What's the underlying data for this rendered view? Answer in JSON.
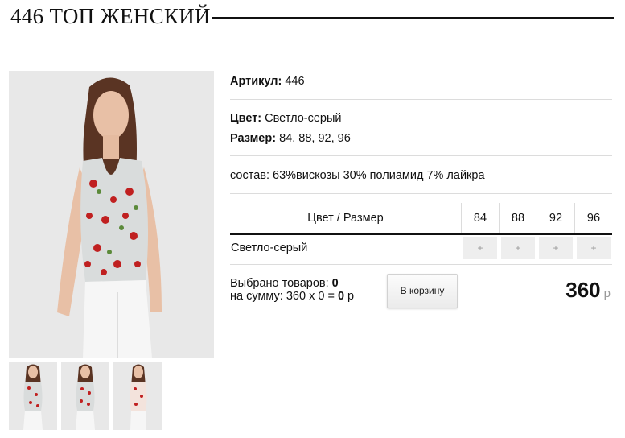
{
  "product": {
    "title": "446 ТОП ЖЕНСКИЙ",
    "article_label": "Артикул:",
    "article_value": "446",
    "color_label": "Цвет:",
    "color_value": "Светло-серый",
    "size_label": "Размер:",
    "size_value": "84, 88, 92, 96",
    "composition": "состав: 63%вискозы 30% полиамид 7% лайкра"
  },
  "size_table": {
    "header": "Цвет / Размер",
    "sizes": [
      "84",
      "88",
      "92",
      "96"
    ],
    "rows": [
      {
        "color": "Светло-серый",
        "cells": [
          "+",
          "+",
          "+",
          "+"
        ]
      }
    ]
  },
  "order": {
    "selected_label": "Выбрано товаров:",
    "selected_count": "0",
    "sum_label": "на сумму: 360 х 0 =",
    "sum_value": "0",
    "sum_currency": "р",
    "cart_button": "В корзину",
    "price": "360",
    "price_currency": "р"
  },
  "gallery": {
    "main_image_icon": "product-photo-icon",
    "thumbnails": [
      "thumb-1",
      "thumb-2",
      "thumb-3"
    ]
  }
}
